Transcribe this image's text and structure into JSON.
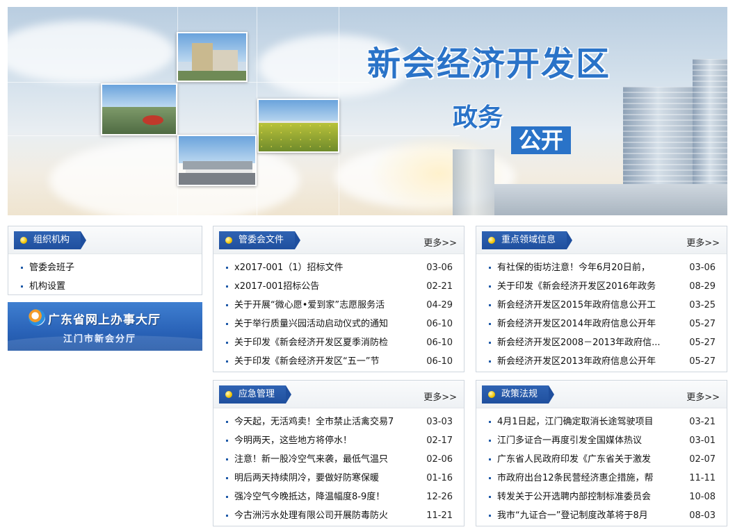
{
  "banner": {
    "title": "新会经济开发区",
    "subtitle_1": "政务",
    "subtitle_2": "公开"
  },
  "sidebar": {
    "org": {
      "heading": "组织机构",
      "items": [
        {
          "label": "管委会班子"
        },
        {
          "label": "机构设置"
        }
      ]
    },
    "service": {
      "line1": "广东省网上办事大厅",
      "line2": "江门市新会分厅"
    }
  },
  "more_label": "更多>>",
  "panels": {
    "committee_docs": {
      "heading": "管委会文件",
      "items": [
        {
          "title": "x2017-001（1）招标文件",
          "date": "03-06"
        },
        {
          "title": "x2017-001招标公告",
          "date": "02-21"
        },
        {
          "title": "关于开展“微心愿•爱到家”志愿服务活",
          "date": "04-29"
        },
        {
          "title": "关于举行质量兴园活动启动仪式的通知",
          "date": "06-10"
        },
        {
          "title": "关于印发《新会经济开发区夏季消防检",
          "date": "06-10"
        },
        {
          "title": "关于印发《新会经济开发区“五一”节",
          "date": "06-10"
        }
      ]
    },
    "key_areas": {
      "heading": "重点领域信息",
      "items": [
        {
          "title": "有社保的街坊注意！今年6月20日前，",
          "date": "03-06"
        },
        {
          "title": "关于印发《新会经济开发区2016年政务",
          "date": "08-29"
        },
        {
          "title": "新会经济开发区2015年政府信息公开工",
          "date": "03-25"
        },
        {
          "title": "新会经济开发区2014年政府信息公开年",
          "date": "05-27"
        },
        {
          "title": "新会经济开发区2008－2013年政府信...",
          "date": "05-27"
        },
        {
          "title": "新会经济开发区2013年政府信息公开年",
          "date": "05-27"
        }
      ]
    },
    "emergency": {
      "heading": "应急管理",
      "items": [
        {
          "title": "今天起，无活鸡卖！全市禁止活禽交易7",
          "date": "03-03"
        },
        {
          "title": "今明两天，这些地方将停水！",
          "date": "02-17"
        },
        {
          "title": "注意！新一股冷空气来袭，最低气温只",
          "date": "02-06"
        },
        {
          "title": "明后两天持续阴冷，要做好防寒保暖",
          "date": "01-16"
        },
        {
          "title": "强冷空气今晚抵达，降温幅度8-9度！",
          "date": "12-26"
        },
        {
          "title": "今古洲污水处理有限公司开展防毒防火",
          "date": "11-21"
        }
      ]
    },
    "policy": {
      "heading": "政策法规",
      "items": [
        {
          "title": "4月1日起，江门确定取消长途驾驶项目",
          "date": "03-21"
        },
        {
          "title": "江门多证合一再度引发全国媒体热议",
          "date": "03-01"
        },
        {
          "title": "广东省人民政府印发《广东省关于激发",
          "date": "02-07"
        },
        {
          "title": "市政府出台12条民营经济惠企措施，帮",
          "date": "11-11"
        },
        {
          "title": "转发关于公开选聘内部控制标准委员会",
          "date": "10-08"
        },
        {
          "title": "我市“九证合一”登记制度改革将于8月",
          "date": "08-03"
        }
      ]
    }
  }
}
